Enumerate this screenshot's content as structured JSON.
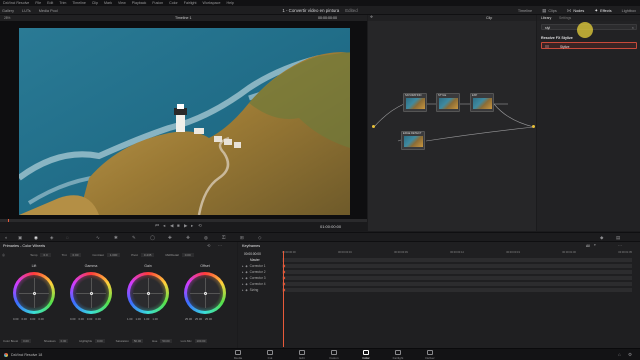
{
  "menubar": {
    "items": [
      "DaVinci Resolve",
      "File",
      "Edit",
      "Trim",
      "Timeline",
      "Clip",
      "Mark",
      "View",
      "Playback",
      "Fusion",
      "Color",
      "Fairlight",
      "Workspace",
      "Help"
    ]
  },
  "toolbar": {
    "left": [
      "Gallery",
      "LUTs",
      "Media Pool"
    ],
    "project_title": "1 - Convertir vídeo en pintura",
    "project_status": "Edited",
    "right": [
      "Timeline",
      "Clips",
      "Nodes",
      "Effects",
      "Lightbox"
    ]
  },
  "viewer": {
    "zoom": "28%",
    "timeline_name": "Timeline 1",
    "timecode_top": "00:00:00:00",
    "timecode_bottom": "01:00:00:00",
    "transport_icons": [
      "skip-back-icon",
      "step-back-icon",
      "play-reverse-icon",
      "stop-icon",
      "play-icon",
      "step-forward-icon",
      "loop-icon"
    ]
  },
  "nodes": {
    "mode": "Clip",
    "items": [
      {
        "id": "01",
        "label": "SATURATION"
      },
      {
        "id": "02",
        "label": "STYLE"
      },
      {
        "id": "03",
        "label": "EXP"
      },
      {
        "id": "04",
        "label": "EDGE DETECT"
      }
    ]
  },
  "library": {
    "tab_library": "Library",
    "tab_settings": "Settings",
    "search_value": "styl",
    "category": "Resolve FX Stylize",
    "result": "Stylize"
  },
  "color_panel": {
    "title": "Primaries - Color Wheels",
    "temp_label": "Temp",
    "temp": "0.0",
    "tint_label": "Tint",
    "tint": "0.00",
    "contrast_label": "Contrast",
    "contrast": "1.000",
    "pivot_label": "Pivot",
    "pivot": "0.435",
    "middetail_label": "Mid/Detail",
    "middetail": "0.00",
    "wheels": [
      {
        "name": "Lift",
        "values": [
          "0.00",
          "0.00",
          "0.00",
          "0.00"
        ]
      },
      {
        "name": "Gamma",
        "values": [
          "0.00",
          "0.00",
          "0.00",
          "0.00"
        ]
      },
      {
        "name": "Gain",
        "values": [
          "1.00",
          "1.00",
          "1.00",
          "1.00"
        ]
      },
      {
        "name": "Offset",
        "values": [
          "25.00",
          "25.00",
          "25.00"
        ]
      }
    ],
    "bottom_labels": [
      "Color Boost",
      "Shadows",
      "Highlights",
      "Saturation",
      "Hue",
      "Lum Mix"
    ],
    "bottom_values": [
      "0.00",
      "0.00",
      "0.00",
      "50.00",
      "50.00",
      "100.00"
    ]
  },
  "keyframes": {
    "title": "Keyframes",
    "filter": "All",
    "timecode": "00:00:00:00",
    "ruler_marks": [
      "00:00:00:00",
      "00:00:00:04",
      "00:00:00:09",
      "00:00:00:14",
      "00:00:00:19",
      "00:00:01:00",
      "00:00:01:05"
    ],
    "tracks": [
      "Master",
      "Corrector 1",
      "Corrector 2",
      "Corrector 3",
      "Corrector 4",
      "Sizing"
    ]
  },
  "pages": [
    "Media",
    "Cut",
    "Edit",
    "Fusion",
    "Color",
    "Fairlight",
    "Deliver"
  ],
  "app_name": "DaVinci Resolve 18",
  "colors": {
    "accent_orange": "#e85a3a",
    "cursor_yellow": "#e8d23a",
    "active_page": "#ffffff"
  }
}
